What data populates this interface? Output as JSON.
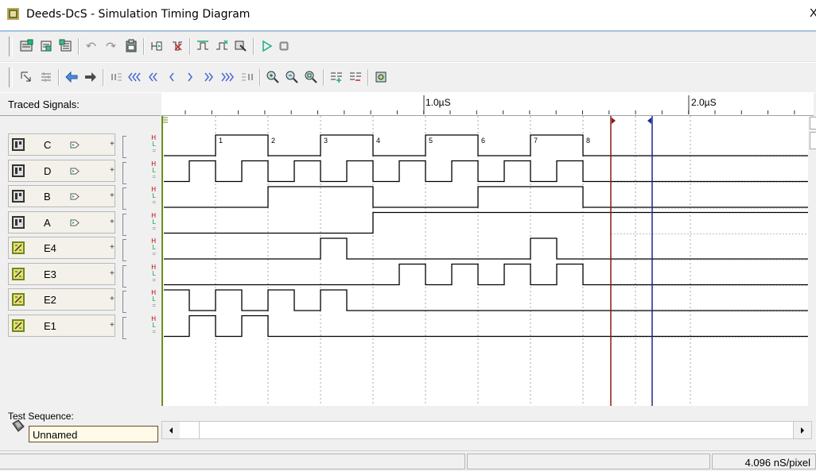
{
  "window": {
    "title": "Deeds-DcS  -  Simulation Timing Diagram",
    "close_glyph": "X"
  },
  "toolbar1": {
    "icons": [
      "new-diagram-icon",
      "open-icon",
      "save-icon",
      "undo-icon",
      "redo-icon",
      "clipboard-icon",
      "insert-signal-icon",
      "delete-signal-icon",
      "insert-step-icon",
      "delete-step-icon",
      "probe-icon",
      "run-icon",
      "stop-icon"
    ]
  },
  "toolbar2": {
    "icons": [
      "cursor-icon",
      "settings-icon",
      "back-icon",
      "forward-icon",
      "go-start-icon",
      "fast-rewind-icon",
      "rewind-icon",
      "step-back-icon",
      "step-forward-icon",
      "forward-fast-icon",
      "fast-forward-icon",
      "go-end-icon",
      "zoom-in-icon",
      "zoom-out-icon",
      "zoom-fit-icon",
      "add-marker-icon",
      "remove-marker-icon",
      "chip-icon"
    ]
  },
  "left_panel": {
    "traced_label": "Traced Signals:",
    "test_label": "Test Sequence:",
    "test_value": "Unnamed"
  },
  "ruler": {
    "label_1": "1.0µS",
    "label_2": "2.0µS"
  },
  "signals": [
    {
      "name": "C",
      "kind": "input",
      "h": "H",
      "l": "L"
    },
    {
      "name": "D",
      "kind": "input",
      "h": "H",
      "l": "L"
    },
    {
      "name": "B",
      "kind": "input",
      "h": "H",
      "l": "L"
    },
    {
      "name": "A",
      "kind": "input",
      "h": "H",
      "l": "L"
    },
    {
      "name": "E4",
      "kind": "output",
      "h": "H",
      "l": "L"
    },
    {
      "name": "E3",
      "kind": "output",
      "h": "H",
      "l": "L"
    },
    {
      "name": "E2",
      "kind": "output",
      "h": "H",
      "l": "L"
    },
    {
      "name": "E1",
      "kind": "output",
      "h": "H",
      "l": "L"
    }
  ],
  "clock_numbers": [
    "1",
    "2",
    "3",
    "4",
    "5",
    "6",
    "7",
    "8"
  ],
  "status": {
    "scale": "4.096 nS/pixel"
  },
  "colors": {
    "accent": "#a8c1dd",
    "wave": "#000000",
    "marker_red": "#8b1a1a",
    "marker_blue": "#1a2a8b",
    "grid": "#a7a7a7",
    "plot_border": "#6f8b1d"
  }
}
